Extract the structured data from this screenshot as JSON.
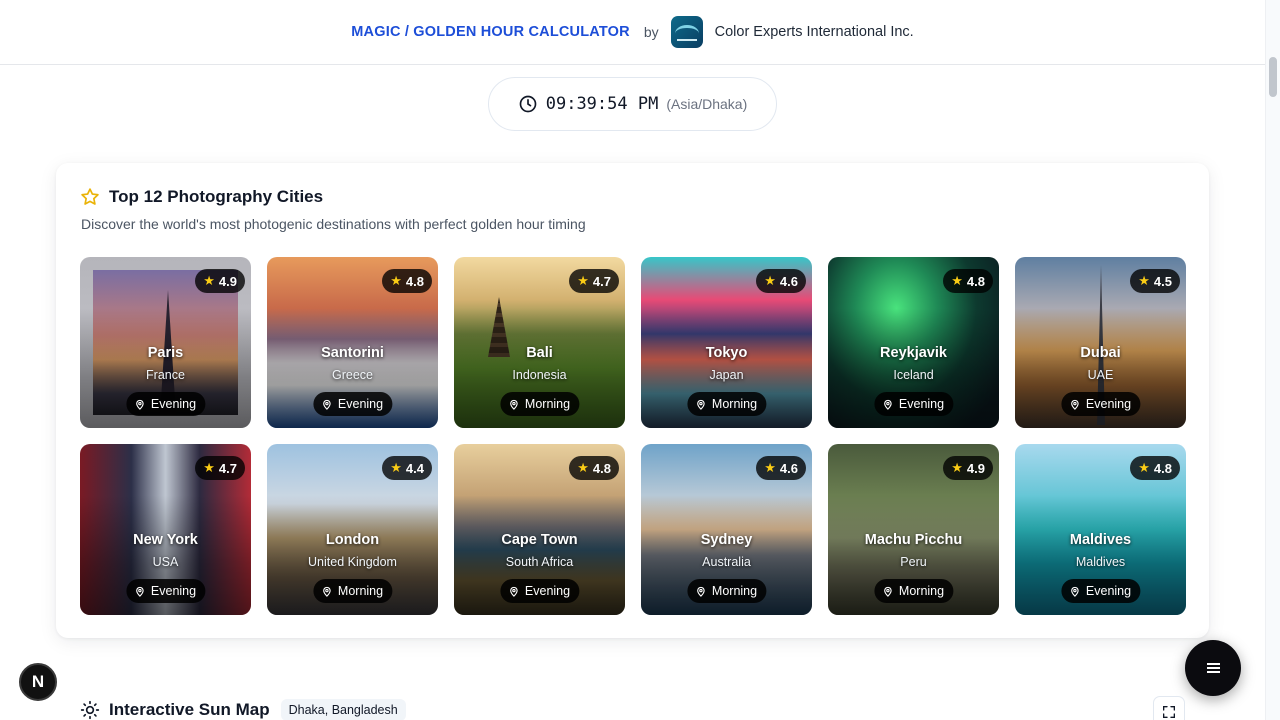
{
  "header": {
    "title_link": "MAGIC / GOLDEN HOUR CALCULATOR",
    "by_label": "by",
    "company": "Color Experts International Inc."
  },
  "clock": {
    "time": "09:39:54 PM",
    "timezone": "(Asia/Dhaka)"
  },
  "cities_section": {
    "title": "Top 12 Photography Cities",
    "subtitle": "Discover the world's most photogenic destinations with perfect golden hour timing",
    "cities": [
      {
        "name": "Paris",
        "country": "France",
        "rating": "4.9",
        "time": "Evening"
      },
      {
        "name": "Santorini",
        "country": "Greece",
        "rating": "4.8",
        "time": "Evening"
      },
      {
        "name": "Bali",
        "country": "Indonesia",
        "rating": "4.7",
        "time": "Morning"
      },
      {
        "name": "Tokyo",
        "country": "Japan",
        "rating": "4.6",
        "time": "Morning"
      },
      {
        "name": "Reykjavik",
        "country": "Iceland",
        "rating": "4.8",
        "time": "Evening"
      },
      {
        "name": "Dubai",
        "country": "UAE",
        "rating": "4.5",
        "time": "Evening"
      },
      {
        "name": "New York",
        "country": "USA",
        "rating": "4.7",
        "time": "Evening"
      },
      {
        "name": "London",
        "country": "United Kingdom",
        "rating": "4.4",
        "time": "Morning"
      },
      {
        "name": "Cape Town",
        "country": "South Africa",
        "rating": "4.8",
        "time": "Evening"
      },
      {
        "name": "Sydney",
        "country": "Australia",
        "rating": "4.6",
        "time": "Morning"
      },
      {
        "name": "Machu Picchu",
        "country": "Peru",
        "rating": "4.9",
        "time": "Morning"
      },
      {
        "name": "Maldives",
        "country": "Maldives",
        "rating": "4.8",
        "time": "Evening"
      }
    ]
  },
  "sun_map": {
    "title": "Interactive Sun Map",
    "location": "Dhaka, Bangladesh"
  },
  "icons": {
    "clock": "clock-icon",
    "star_outline": "star-outline-icon",
    "rating_star": "star-filled-icon",
    "pin": "map-pin-icon",
    "menu": "menu-icon",
    "sun": "sun-icon",
    "expand": "expand-icon"
  },
  "colors": {
    "accent": "#1d4ed8",
    "star": "#facc15"
  }
}
